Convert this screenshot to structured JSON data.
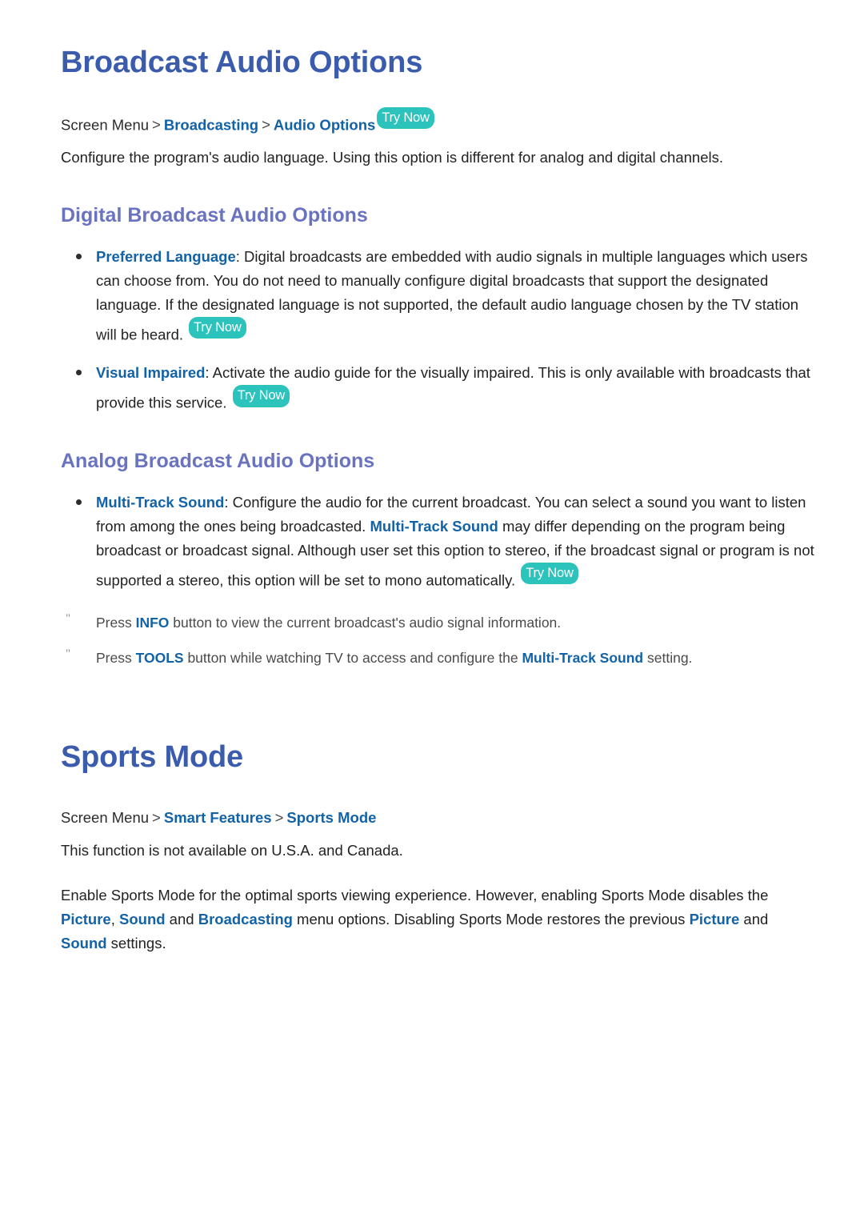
{
  "doc": {
    "badge_label": "Try Now",
    "breadcrumb_separator": ">",
    "note_marker": "\"",
    "colors": {
      "heading_primary": "#3b5cad",
      "heading_secondary": "#6a73c0",
      "link": "#1262a8",
      "badge_teal": "#2bc3bb",
      "body_text": "#222222",
      "note_text": "#4a4a4a"
    }
  },
  "sections": [
    {
      "id": "broadcast-audio-options",
      "title": "Broadcast Audio Options",
      "breadcrumb": {
        "root": "Screen Menu",
        "items": [
          "Broadcasting",
          "Audio Options"
        ],
        "has_try_now": true
      },
      "intro": "Configure the program's audio language. Using this option is different for analog and digital channels.",
      "sub_sections": [
        {
          "id": "digital-broadcast-audio-options",
          "title": "Digital Broadcast Audio Options",
          "bullets": [
            {
              "term": "Preferred Language",
              "text_after_term": ": Digital broadcasts are embedded with audio signals in multiple languages which users can choose from. You do not need to manually configure digital broadcasts that support the designated language. If the designated language is not supported, the default audio language chosen by the TV station will be heard.",
              "has_try_now": true
            },
            {
              "term": "Visual Impaired",
              "text_after_term": ": Activate the audio guide for the visually impaired. This is only available with broadcasts that provide this service.",
              "has_try_now": true
            }
          ]
        },
        {
          "id": "analog-broadcast-audio-options",
          "title": "Analog Broadcast Audio Options",
          "bullets": [
            {
              "term": "Multi-Track Sound",
              "segment_1": ": Configure the audio for the current broadcast. You can select a sound you want to listen from among the ones being broadcasted. ",
              "inline_link": "Multi-Track Sound",
              "segment_2": " may differ depending on the program being broadcast or broadcast signal. Although user set this option to stereo, if the broadcast signal or program is not supported a stereo, this option will be set to mono automatically.",
              "has_try_now": true
            }
          ],
          "notes": [
            {
              "prefix": "Press ",
              "key": "INFO",
              "suffix": " button to view the current broadcast's audio signal information."
            },
            {
              "prefix": "Press ",
              "key": "TOOLS",
              "middle": " button while watching TV to access and configure the ",
              "key2": "Multi-Track Sound",
              "suffix": " setting."
            }
          ]
        }
      ]
    },
    {
      "id": "sports-mode",
      "title": "Sports Mode",
      "breadcrumb": {
        "root": "Screen Menu",
        "items": [
          "Smart Features",
          "Sports Mode"
        ],
        "has_try_now": false
      },
      "availability_note": "This function is not available on U.S.A. and Canada.",
      "body": {
        "part_1": "Enable Sports Mode for the optimal sports viewing experience. However, enabling Sports Mode disables the ",
        "link_1": "Picture",
        "part_2": ", ",
        "link_2": "Sound",
        "part_3": " and ",
        "link_3": "Broadcasting",
        "part_4": " menu options. Disabling Sports Mode restores the previous ",
        "link_4": "Picture",
        "part_5": " and ",
        "link_5": "Sound",
        "part_6": " settings."
      }
    }
  ]
}
